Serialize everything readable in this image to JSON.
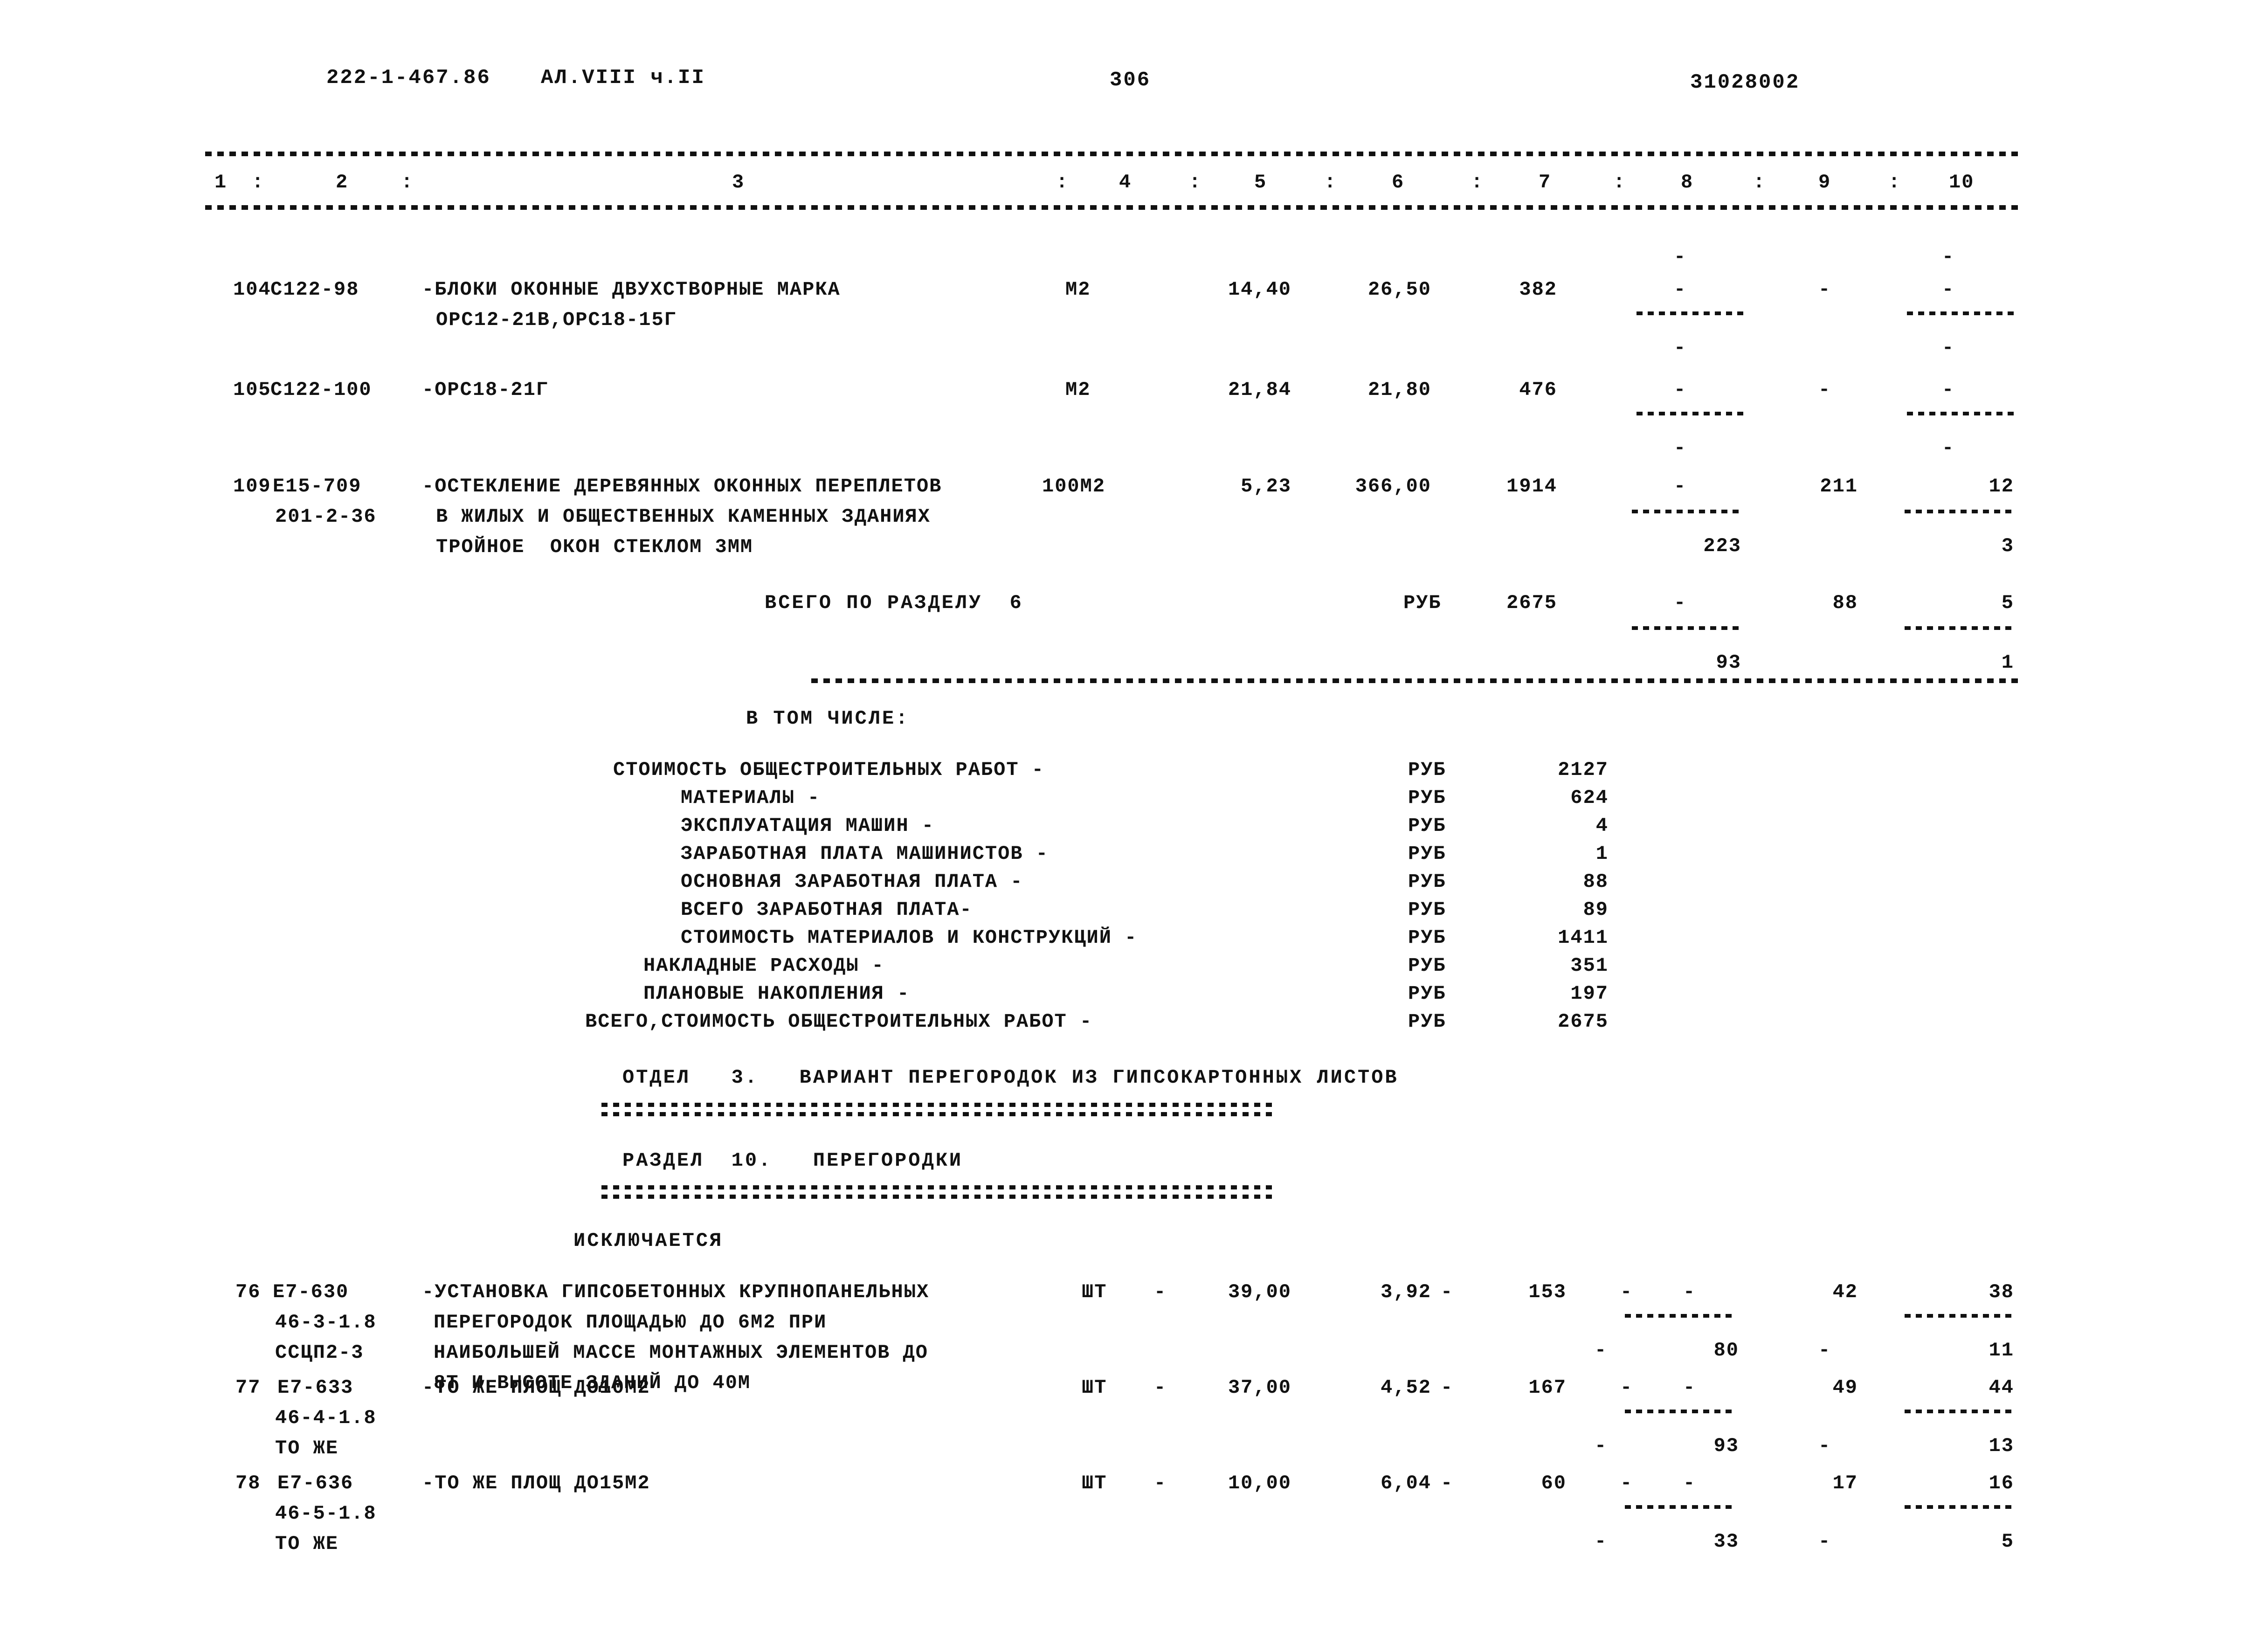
{
  "header": {
    "project_code": "222-1-467.86",
    "album": "АЛ.VIII ч.II",
    "page_number": "306",
    "doc_code": "31028002"
  },
  "table": {
    "column_headers": [
      "1",
      "2",
      "3",
      "4",
      "5",
      "6",
      "7",
      "8",
      "9",
      "10"
    ],
    "separator": ":",
    "rows": [
      {
        "no": "104",
        "code": "С122-98",
        "desc_lines": [
          "-БЛОКИ ОКОННЫЕ ДВУХСТВОРНЫЕ МАРКА",
          "ОРС12-21В,ОРС18-15Г"
        ],
        "sub_codes": [],
        "unit": "М2",
        "col5": "14,40",
        "col6": "26,50",
        "col7": "382",
        "col8_top": "-",
        "col8_bot": "-",
        "col8_above": "-",
        "col9": "-",
        "col10_top": "-",
        "col10_bot": "-",
        "col10_above": "-"
      },
      {
        "no": "105",
        "code": "С122-100",
        "desc_lines": [
          "-ОРС18-21Г"
        ],
        "sub_codes": [],
        "unit": "М2",
        "col5": "21,84",
        "col6": "21,80",
        "col7": "476",
        "col8_top": "-",
        "col8_bot": "-",
        "col9": "-",
        "col10_top": "-",
        "col10_bot": "-"
      },
      {
        "no": "109",
        "code": "Е15-709",
        "desc_lines": [
          "-ОСТЕКЛЕНИЕ ДЕРЕВЯННЫХ ОКОННЫХ ПЕРЕПЛЕТОВ",
          "В ЖИЛЫХ И ОБЩЕСТВЕННЫХ КАМЕННЫХ ЗДАНИЯХ",
          "ТРОЙНОЕ  ОКОН СТЕКЛОМ 3ММ"
        ],
        "sub_codes": [
          "201-2-36"
        ],
        "unit": "100М2",
        "col5": "5,23",
        "col6": "366,00",
        "col7": "1914",
        "col8_top": "-",
        "col8_bot": "223",
        "col9": "211",
        "col10_top": "12",
        "col10_bot": "3"
      }
    ],
    "section_total": {
      "label": "ВСЕГО ПО РАЗДЕЛУ  6",
      "unit": "РУБ",
      "col7": "2675",
      "col8_top": "-",
      "col8_bot": "93",
      "col9": "88",
      "col10_top": "5",
      "col10_bot": "1"
    }
  },
  "breakdown": {
    "title": "В ТОМ ЧИСЛЕ:",
    "items": [
      {
        "label": "СТОИМОСТЬ ОБЩЕСТРОИТЕЛЬНЫХ РАБОТ -",
        "unit": "РУБ",
        "value": "2127",
        "indent": 0
      },
      {
        "label": "МАТЕРИАЛЫ -",
        "unit": "РУБ",
        "value": "624",
        "indent": 1
      },
      {
        "label": "ЭКСПЛУАТАЦИЯ МАШИН -",
        "unit": "РУБ",
        "value": "4",
        "indent": 1
      },
      {
        "label": "ЗАРАБОТНАЯ ПЛАТА МАШИНИСТОВ -",
        "unit": "РУБ",
        "value": "1",
        "indent": 1
      },
      {
        "label": "ОСНОВНАЯ ЗАРАБОТНАЯ ПЛАТА -",
        "unit": "РУБ",
        "value": "88",
        "indent": 1
      },
      {
        "label": "ВСЕГО ЗАРАБОТНАЯ ПЛАТА-",
        "unit": "РУБ",
        "value": "89",
        "indent": 1
      },
      {
        "label": "СТОИМОСТЬ МАТЕРИАЛОВ И КОНСТРУКЦИЙ -",
        "unit": "РУБ",
        "value": "1411",
        "indent": 1
      },
      {
        "label": "НАКЛАДНЫЕ РАСХОДЫ -",
        "unit": "РУБ",
        "value": "351",
        "indent": 0
      },
      {
        "label": "ПЛАНОВЫЕ НАКОПЛЕНИЯ -",
        "unit": "РУБ",
        "value": "197",
        "indent": 0
      },
      {
        "label": "ВСЕГО,СТОИМОСТЬ ОБЩЕСТРОИТЕЛЬНЫХ РАБОТ -",
        "unit": "РУБ",
        "value": "2675",
        "indent": 0
      }
    ]
  },
  "sections": {
    "otdel": "ОТДЕЛ   3.   ВАРИАНТ ПЕРЕГОРОДОК ИЗ ГИПСОКАРТОННЫХ ЛИСТОВ",
    "razdel": "РАЗДЕЛ  10.   ПЕРЕГОРОДКИ",
    "excluded_label": "ИСКЛЮЧАЕТСЯ"
  },
  "table2": {
    "rows": [
      {
        "no": "76",
        "code": "Е7-630",
        "sub_codes": [
          "46-3-1.8",
          "ССЦП2-3"
        ],
        "desc_lines": [
          "-УСТАНОВКА ГИПСОБЕТОННЫХ КРУПНОПАНЕЛЬНЫХ",
          "ПЕРЕГОРОДОК ПЛОЩАДЬЮ ДО 6М2 ПРИ",
          "НАИБОЛЬШЕЙ МАССЕ МОНТАЖНЫХ ЭЛЕМЕНТОВ ДО",
          "8Т И ВЫСОТЕ ЗДАНИЙ ДО 40М"
        ],
        "unit": "ШТ",
        "col4": "-",
        "col5": "39,00",
        "col6": "3,92",
        "col6_dash": "-",
        "col7": "153",
        "col8_top": "-",
        "col8b_top": "-",
        "col8_bot_dash": "-",
        "col8_bot": "80",
        "col9": "42",
        "col9_bot": "-",
        "col10_top": "38",
        "col10_bot": "11"
      },
      {
        "no": "77",
        "code": "Е7-633",
        "sub_codes": [
          "46-4-1.8",
          "ТО ЖЕ"
        ],
        "desc_lines": [
          "-ТО ЖЕ ПЛОЩ ДО10М2"
        ],
        "unit": "ШТ",
        "col4": "-",
        "col5": "37,00",
        "col6": "4,52",
        "col6_dash": "-",
        "col7": "167",
        "col8_top": "-",
        "col8b_top": "-",
        "col8_bot_dash": "-",
        "col8_bot": "93",
        "col9": "49",
        "col9_bot": "-",
        "col10_top": "44",
        "col10_bot": "13"
      },
      {
        "no": "78",
        "code": "Е7-636",
        "sub_codes": [
          "46-5-1.8",
          "ТО ЖЕ"
        ],
        "desc_lines": [
          "-ТО ЖЕ ПЛОЩ ДО15М2"
        ],
        "unit": "ШТ",
        "col4": "-",
        "col5": "10,00",
        "col6": "6,04",
        "col6_dash": "-",
        "col7": "60",
        "col8_top": "-",
        "col8b_top": "-",
        "col8_bot_dash": "-",
        "col8_bot": "33",
        "col9": "17",
        "col9_bot": "-",
        "col10_top": "16",
        "col10_bot": "5"
      }
    ]
  }
}
